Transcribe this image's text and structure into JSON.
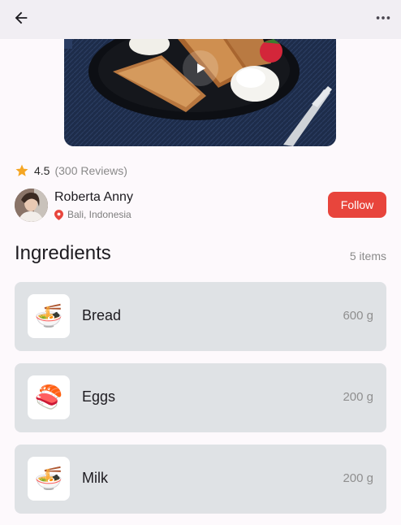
{
  "header": {
    "back_icon": "arrow-left-icon",
    "menu_icon": "more-horizontal-icon"
  },
  "video": {
    "play_icon": "play-icon"
  },
  "rating": {
    "value": "4.5",
    "reviews": "(300 Reviews)",
    "star_color": "#f5a623"
  },
  "author": {
    "name": "Roberta Anny",
    "location": "Bali, Indonesia",
    "follow_label": "Follow",
    "accent": "#e8453c"
  },
  "ingredients": {
    "title": "Ingredients",
    "count": "5 items",
    "items": [
      {
        "name": "Bread",
        "qty": "600 g",
        "icon": "🍜"
      },
      {
        "name": "Eggs",
        "qty": "200 g",
        "icon": "🍣"
      },
      {
        "name": "Milk",
        "qty": "200 g",
        "icon": "🍜"
      }
    ]
  }
}
